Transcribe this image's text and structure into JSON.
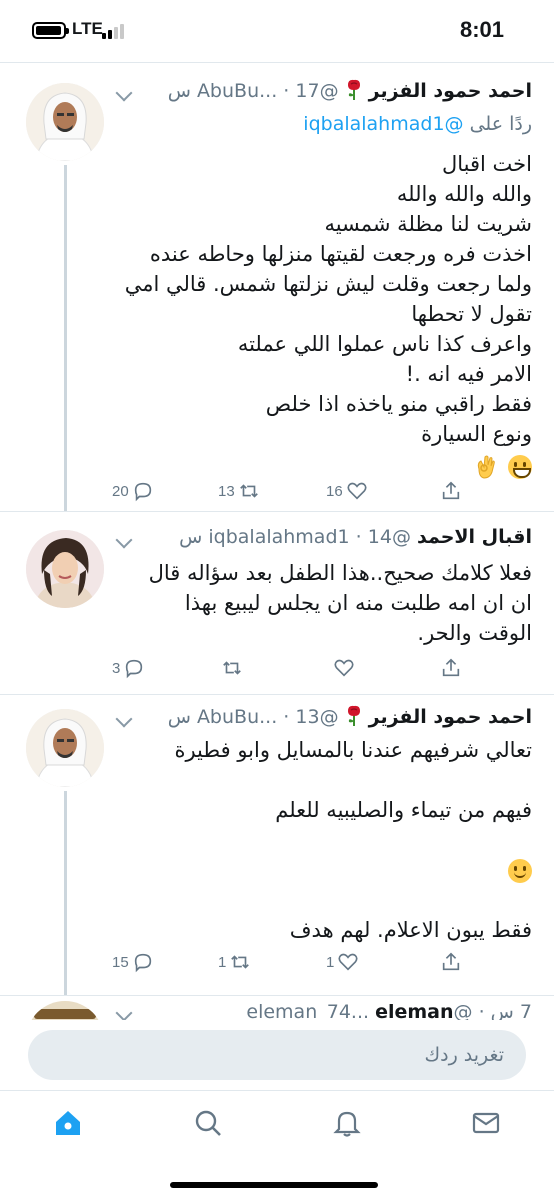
{
  "status_bar": {
    "network": "LTE",
    "time": "8:01"
  },
  "tweets": [
    {
      "name": "احمد حمود الفزير",
      "name_emoji": "rose",
      "handle": "@AbuBu...",
      "time": "17 س",
      "reply_prefix": "ردًا على",
      "reply_handle": "@iqbalalahmad1",
      "lines": [
        "اخت اقبال",
        "والله والله والله",
        "شريت لنا مظلة شمسيه",
        "اخذت فره ورجعت لقيتها منزلها وحاطه عنده",
        "ولما رجعت وقلت ليش نزلتها شمس. قالي امي",
        "تقول لا تحطها",
        "واعرف كذا ناس عملوا اللي عملته",
        "الامر فيه انه .!",
        "فقط راقبي منو ياخذه اذا خلص",
        "ونوع السيارة"
      ],
      "emoji_line": [
        "grinning-face",
        "ok-hand"
      ],
      "replies": "20",
      "retweets": "13",
      "likes": "16"
    },
    {
      "name": "اقبال الاحمد",
      "handle": "@iqbalalahmad1",
      "time": "14 س",
      "lines": [
        "فعلا كلامك صحيح..هذا الطفل بعد سؤاله قال",
        "ان ان امه طلبت منه ان يجلس ليبيع بهذا",
        "الوقت والحر."
      ],
      "replies": "3",
      "retweets": "",
      "likes": ""
    },
    {
      "name": "احمد حمود الفزير",
      "name_emoji": "rose",
      "handle": "@AbuBu...",
      "time": "13 س",
      "lines": [
        "تعالي شرفيهم عندنا بالمسايل وابو فطيرة",
        "",
        "فيهم من تيماء والصليبيه للعلم",
        "",
        "",
        "",
        "فقط يبون الاعلام. لهم هدف"
      ],
      "emoji_line_index": 4,
      "emoji": "slightly-smiling-face",
      "replies": "15",
      "retweets": "1",
      "likes": "1"
    }
  ],
  "peek_tweet": {
    "name": "eleman",
    "handle": "@eleman_74...",
    "time": "7 س"
  },
  "compose": {
    "placeholder": "تغريد ردك"
  },
  "tabs": [
    "home-icon",
    "search-icon",
    "notifications-icon",
    "messages-icon"
  ],
  "colors": {
    "accent": "#1da1f2",
    "secondary_text": "#657786",
    "divider": "#e1e8ed"
  }
}
